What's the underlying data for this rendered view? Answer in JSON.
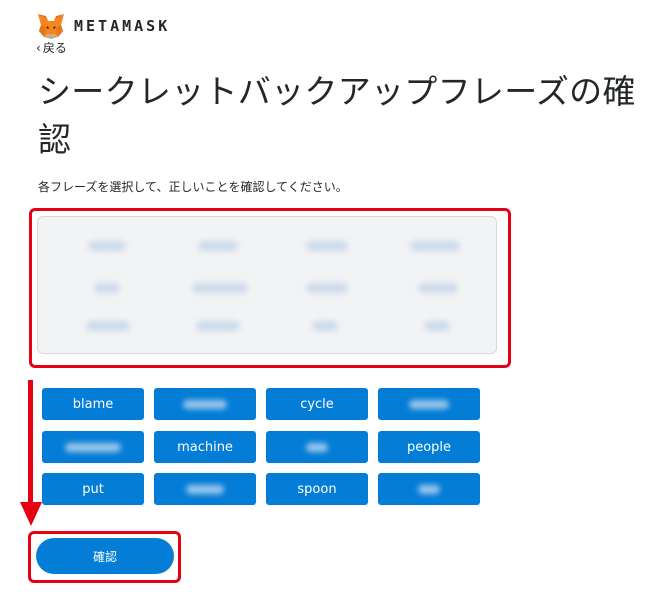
{
  "header": {
    "brand": "METAMASK",
    "back_label": "戻る"
  },
  "page": {
    "title": "シークレットバックアップフレーズの確認",
    "instruction": "各フレーズを選択して、正しいことを確認してください。"
  },
  "word_buttons": [
    "blame",
    "",
    "cycle",
    "",
    "",
    "machine",
    "",
    "people",
    "put",
    "",
    "spoon",
    ""
  ],
  "confirm_label": "確認",
  "colors": {
    "accent": "#037dd6",
    "highlight": "#e60012"
  },
  "icons": {
    "logo": "metamask-fox-icon",
    "back": "chevron-left-icon",
    "annotation": "red-down-arrow-icon"
  }
}
